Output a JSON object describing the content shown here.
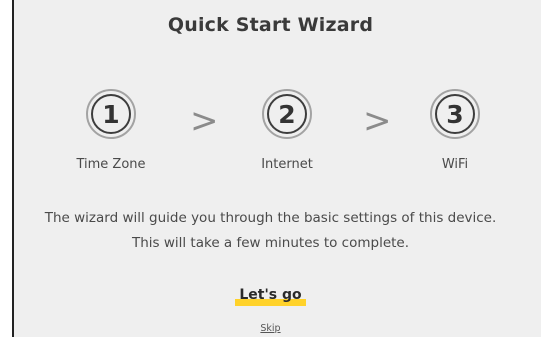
{
  "wizard": {
    "title": "Quick Start Wizard",
    "steps": [
      {
        "number": "1",
        "label": "Time Zone"
      },
      {
        "number": "2",
        "label": "Internet"
      },
      {
        "number": "3",
        "label": "WiFi"
      }
    ],
    "separator": ">",
    "description_line1": "The wizard will guide you through the basic settings of this device.",
    "description_line2": "This will take a few minutes to complete.",
    "start_label": "Let's go",
    "skip_label": "Skip"
  },
  "colors": {
    "panel_background": "#efefef",
    "accent_highlight": "#ffd22a",
    "text": "#4a4a4a"
  }
}
